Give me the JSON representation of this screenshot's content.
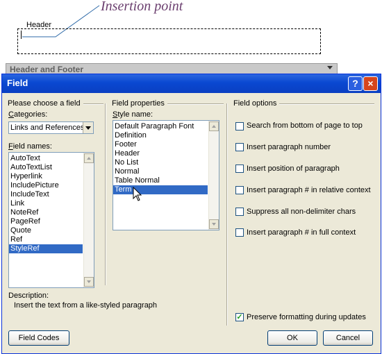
{
  "annotation": {
    "callout": "Insertion point",
    "header_label": "Header"
  },
  "toolbar": {
    "title": "Header and Footer"
  },
  "dialog": {
    "title": "Field",
    "help_icon": "?",
    "close_icon": "×",
    "left_group": {
      "title": "Please choose a field",
      "categories_label": "Categories:",
      "categories_value": "Links and References",
      "field_names_label": "Field names:",
      "field_names": [
        "AutoText",
        "AutoTextList",
        "Hyperlink",
        "IncludePicture",
        "IncludeText",
        "Link",
        "NoteRef",
        "PageRef",
        "Quote",
        "Ref",
        "StyleRef"
      ],
      "selected_field": "StyleRef"
    },
    "middle_group": {
      "title": "Field properties",
      "style_name_label": "Style name:",
      "styles": [
        "Default Paragraph Font",
        "Definition",
        "Footer",
        "Header",
        "No List",
        "Normal",
        "Table Normal",
        "Term"
      ],
      "selected_style": "Term"
    },
    "right_group": {
      "title": "Field options",
      "options": [
        {
          "label": "Search from bottom of page to top",
          "checked": false
        },
        {
          "label": "Insert paragraph number",
          "checked": false
        },
        {
          "label": "Insert position of paragraph",
          "checked": false
        },
        {
          "label": "Insert paragraph # in relative context",
          "checked": false
        },
        {
          "label": "Suppress all non-delimiter chars",
          "checked": false
        },
        {
          "label": "Insert paragraph # in full context",
          "checked": false
        }
      ],
      "preserve_label": "Preserve formatting during updates",
      "preserve_checked": true
    },
    "description_label": "Description:",
    "description_text": "Insert the text from a like-styled paragraph",
    "buttons": {
      "field_codes": "Field Codes",
      "ok": "OK",
      "cancel": "Cancel"
    }
  },
  "colors": {
    "title_bar": "#0a48d1",
    "selection": "#316ac5",
    "dialog_bg": "#ece9d8",
    "callout": "#6b3f6f"
  }
}
